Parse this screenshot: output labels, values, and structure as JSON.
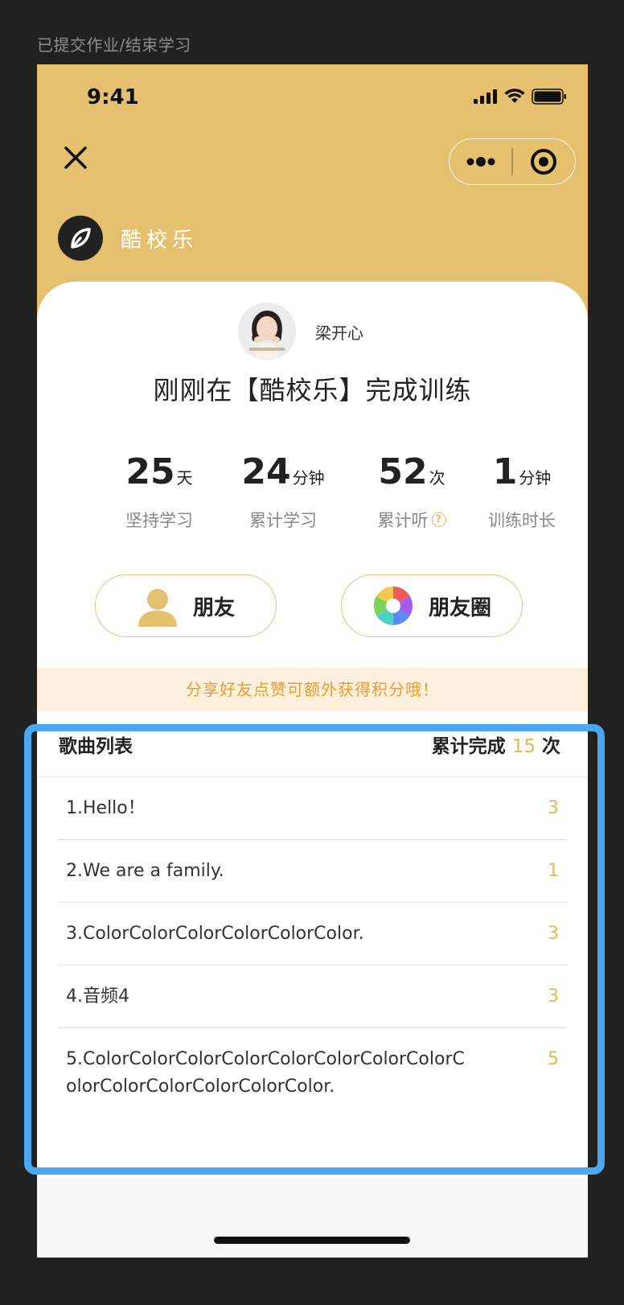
{
  "page_caption": "已提交作业/结束学习",
  "status": {
    "time": "9:41"
  },
  "brand": {
    "name": "酷校乐"
  },
  "user": {
    "name": "梁开心"
  },
  "headline": "刚刚在【酷校乐】完成训练",
  "stats": [
    {
      "value": "25",
      "unit": "天",
      "label": "坚持学习"
    },
    {
      "value": "24",
      "unit": "分钟",
      "label": "累计学习"
    },
    {
      "value": "52",
      "unit": "次",
      "label": "累计听"
    },
    {
      "value": "1",
      "unit": "分钟",
      "label": "训练时长"
    }
  ],
  "share": {
    "friends": "朋友",
    "moments": "朋友圈"
  },
  "notice": "分享好友点赞可额外获得积分哦！",
  "songs": {
    "title": "歌曲列表",
    "total_prefix": "累计完成",
    "total_count": "15",
    "total_suffix": "次",
    "items": [
      {
        "title": "1.Hello！",
        "count": "3"
      },
      {
        "title": "2.We are a family.",
        "count": "1"
      },
      {
        "title": "3.ColorColorColorColorColorColor.",
        "count": "3"
      },
      {
        "title": "4.音频4",
        "count": "3"
      },
      {
        "title": "5.ColorColorColorColorColorColorColorColorColorColorColorColorColorColor.",
        "count": "5"
      }
    ]
  },
  "colors": {
    "accent": "#e5c06e",
    "count": "#e5b755",
    "notice_text": "#f29a2e",
    "highlight": "#4aa7f2"
  }
}
